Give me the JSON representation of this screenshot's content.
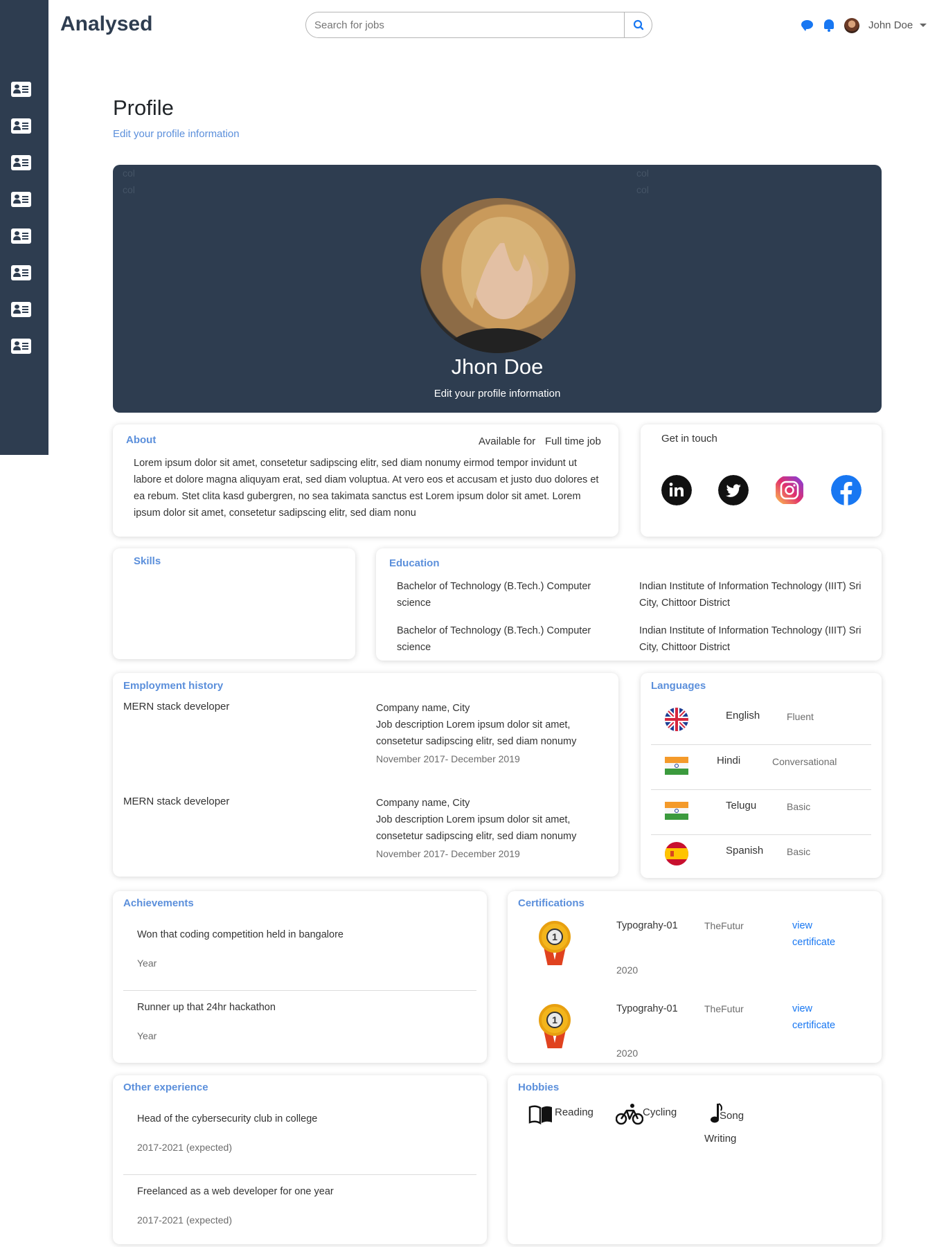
{
  "brand": "Analysed",
  "search": {
    "placeholder": "Search for jobs"
  },
  "nav": {
    "user_name": "John Doe"
  },
  "sidebar": {
    "items": [
      "contact-card-icon",
      "contact-card-icon",
      "contact-card-icon",
      "contact-card-icon",
      "contact-card-icon",
      "contact-card-icon",
      "contact-card-icon",
      "contact-card-icon"
    ]
  },
  "page": {
    "title": "Profile",
    "subtitle": "Edit your profile information"
  },
  "hero": {
    "col_label": "col",
    "name": "Jhon Doe",
    "subtitle": "Edit your profile information"
  },
  "about": {
    "title": "About",
    "available_label": "Available for",
    "available_value": "Full time job",
    "text": "Lorem ipsum dolor sit amet, consetetur sadipscing elitr, sed diam nonumy eirmod tempor invidunt ut labore et dolore magna aliquyam erat, sed diam voluptua. At vero eos et accusam et justo duo dolores et ea rebum. Stet clita kasd gubergren, no sea takimata sanctus est Lorem ipsum dolor sit amet. Lorem ipsum dolor sit amet, consetetur sadipscing elitr, sed diam nonu"
  },
  "contact": {
    "title": "Get in touch",
    "socials": [
      "linkedin-icon",
      "twitter-icon",
      "instagram-icon",
      "facebook-icon"
    ]
  },
  "skills": {
    "title": "Skills"
  },
  "education": {
    "title": "Education",
    "items": [
      {
        "degree": "Bachelor of Technology (B.Tech.) Computer science",
        "institute": "Indian Institute of Information Technology (IIIT) Sri City, Chittoor District"
      },
      {
        "degree": "Bachelor of Technology (B.Tech.) Computer science",
        "institute": "Indian Institute of Information Technology (IIIT) Sri City, Chittoor District"
      }
    ]
  },
  "employment": {
    "title": "Employment history",
    "items": [
      {
        "role": "MERN stack developer",
        "company": "Company name, City",
        "description": "Job description Lorem ipsum dolor sit amet, consetetur sadipscing elitr, sed diam nonumy",
        "period": "November 2017- December 2019"
      },
      {
        "role": "MERN stack developer",
        "company": "Company name, City",
        "description": "Job description Lorem ipsum dolor sit amet, consetetur sadipscing elitr, sed diam nonumy",
        "period": "November 2017- December 2019"
      }
    ]
  },
  "languages": {
    "title": "Languages",
    "items": [
      {
        "flag": "uk-flag-icon",
        "name": "English",
        "level": "Fluent"
      },
      {
        "flag": "india-flag-icon",
        "name": "Hindi",
        "level": "Conversational"
      },
      {
        "flag": "india-flag-icon",
        "name": "Telugu",
        "level": "Basic"
      },
      {
        "flag": "spain-flag-icon",
        "name": "Spanish",
        "level": "Basic"
      }
    ]
  },
  "achievements": {
    "title": "Achievements",
    "items": [
      {
        "text": "Won that coding competition held in bangalore",
        "year": "Year"
      },
      {
        "text": "Runner up that 24hr hackathon",
        "year": "Year"
      }
    ]
  },
  "certifications": {
    "title": "Certifications",
    "items": [
      {
        "name": "Typograhy-01",
        "issuer": "TheFutur",
        "link": "view certificate",
        "year": "2020",
        "badge": "1"
      },
      {
        "name": "Typograhy-01",
        "issuer": "TheFutur",
        "link": "view certificate",
        "year": "2020",
        "badge": "1"
      }
    ]
  },
  "other_experience": {
    "title": "Other experience",
    "items": [
      {
        "text": "Head of the cybersecurity club in college",
        "period": "2017-2021 (expected)"
      },
      {
        "text": "Freelanced as a web developer for one year",
        "period": "2017-2021 (expected)"
      }
    ]
  },
  "hobbies": {
    "title": "Hobbies",
    "items": [
      {
        "icon": "book-icon",
        "label": "Reading"
      },
      {
        "icon": "bicycle-icon",
        "label": "Cycling"
      },
      {
        "icon": "music-note-icon",
        "label": "Song Writing"
      }
    ]
  },
  "colors": {
    "sidebar": "#2e3d50",
    "accent": "#5b8fdb",
    "link": "#1877f2"
  }
}
